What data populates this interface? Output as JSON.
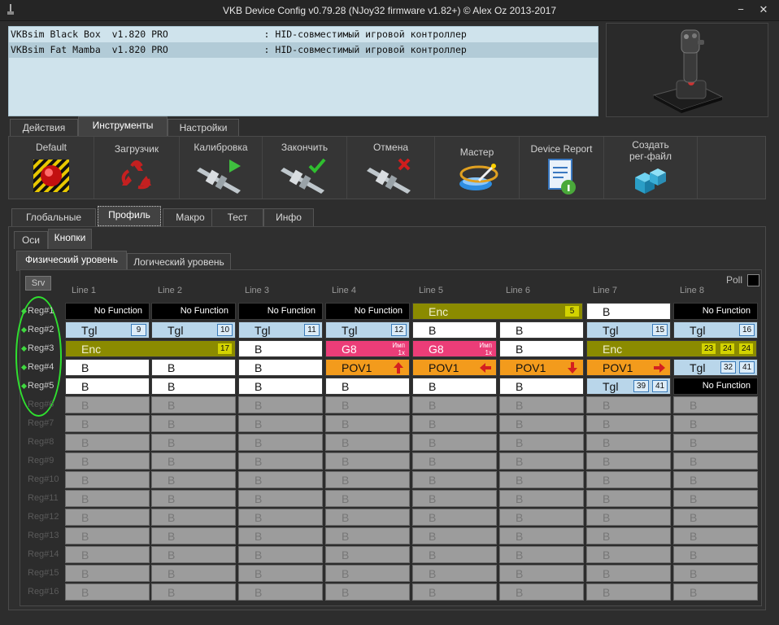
{
  "window": {
    "title": "VKB Device Config v0.79.28 (NJoy32 firmware v1.82+) © Alex Oz 2013-2017",
    "minimize": "−",
    "close": "✕"
  },
  "devices": [
    "VKBsim Black Box  v1.820 PRO                 : HID-совместимый игровой контроллер",
    "VKBsim Fat Mamba  v1.820 PRO                 : HID-совместимый игровой контроллер"
  ],
  "main_tabs": [
    "Действия",
    "Инструменты",
    "Настройки"
  ],
  "tools": [
    "Default",
    "Загрузчик",
    "Калибровка",
    "Закончить",
    "Отмена",
    "Мастер",
    "Device Report",
    "Создать\nрег-файл"
  ],
  "profile_tabs": [
    "Глобальные",
    "Профиль",
    "Макро",
    "Тест",
    "Инфо"
  ],
  "sub_tabs": [
    "Оси",
    "Кнопки"
  ],
  "level_tabs": [
    "Физический уровень",
    "Логический уровень"
  ],
  "srv_label": "Srv",
  "poll_label": "Poll",
  "line_headers": [
    "Line 1",
    "Line 2",
    "Line 3",
    "Line 4",
    "Line 5",
    "Line 6",
    "Line 7",
    "Line 8"
  ],
  "reg_labels": [
    "Reg#1",
    "Reg#2",
    "Reg#3",
    "Reg#4",
    "Reg#5",
    "Reg#6",
    "Reg#7",
    "Reg#8",
    "Reg#9",
    "Reg#10",
    "Reg#11",
    "Reg#12",
    "Reg#13",
    "Reg#14",
    "Reg#15",
    "Reg#16"
  ],
  "grid": [
    [
      {
        "t": "nf",
        "label": "No Function"
      },
      {
        "t": "nf",
        "label": "No Function"
      },
      {
        "t": "nf",
        "label": "No Function"
      },
      {
        "t": "nf",
        "label": "No Function"
      },
      {
        "t": "enc",
        "label": "Enc",
        "span": 2,
        "badges": [
          "5"
        ]
      },
      null,
      {
        "t": "w",
        "label": "B"
      },
      {
        "t": "nf",
        "label": "No Function"
      }
    ],
    [
      {
        "t": "tgl",
        "label": "Tgl",
        "badges": [
          "9"
        ]
      },
      {
        "t": "tgl",
        "label": "Tgl",
        "badges": [
          "10"
        ]
      },
      {
        "t": "tgl",
        "label": "Tgl",
        "badges": [
          "11"
        ]
      },
      {
        "t": "tgl",
        "label": "Tgl",
        "badges": [
          "12"
        ]
      },
      {
        "t": "w",
        "label": "B"
      },
      {
        "t": "w",
        "label": "B"
      },
      {
        "t": "tgl",
        "label": "Tgl",
        "badges": [
          "15"
        ]
      },
      {
        "t": "tgl",
        "label": "Tgl",
        "badges": [
          "16"
        ]
      }
    ],
    [
      {
        "t": "enc",
        "label": "Enc",
        "span": 2,
        "badges": [
          "17"
        ]
      },
      null,
      {
        "t": "w",
        "label": "B"
      },
      {
        "t": "pink",
        "label": "G8",
        "imp": "Имп\n1x"
      },
      {
        "t": "pink",
        "label": "G8",
        "imp": "Имп\n1x"
      },
      {
        "t": "w",
        "label": "B"
      },
      {
        "t": "enc",
        "label": "Enc",
        "span": 2,
        "badges": [
          "23",
          "24",
          "24"
        ]
      },
      null
    ],
    [
      {
        "t": "w",
        "label": "B"
      },
      {
        "t": "w",
        "label": "B"
      },
      {
        "t": "w",
        "label": "B"
      },
      {
        "t": "orange",
        "label": "POV1",
        "arrow": "up"
      },
      {
        "t": "orange",
        "label": "POV1",
        "arrow": "left"
      },
      {
        "t": "orange",
        "label": "POV1",
        "arrow": "down"
      },
      {
        "t": "orange",
        "label": "POV1",
        "arrow": "right"
      },
      {
        "t": "tgl",
        "label": "Tgl",
        "badges": [
          "32",
          "41"
        ]
      }
    ],
    [
      {
        "t": "w",
        "label": "B"
      },
      {
        "t": "w",
        "label": "B"
      },
      {
        "t": "w",
        "label": "B"
      },
      {
        "t": "w",
        "label": "B"
      },
      {
        "t": "w",
        "label": "B"
      },
      {
        "t": "w",
        "label": "B"
      },
      {
        "t": "tgl",
        "label": "Tgl",
        "badges": [
          "39",
          "41"
        ]
      },
      {
        "t": "nf",
        "label": "No Function"
      }
    ]
  ],
  "empty_label": "B",
  "colors": {
    "accent_green": "#2fe02f",
    "enc": "#8b8b00",
    "pink": "#ec3d78",
    "orange": "#f39b1c",
    "tgl": "#b9d6ea"
  }
}
